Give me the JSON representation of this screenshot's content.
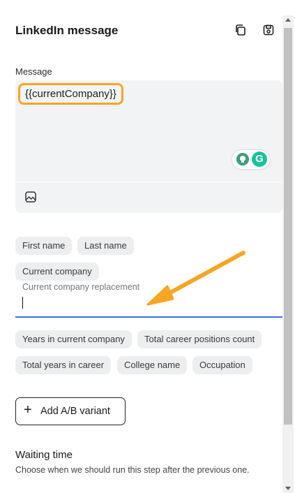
{
  "header": {
    "title": "LinkedIn message",
    "copy_icon": "copy-icon",
    "save_icon": "save-icon"
  },
  "message": {
    "label": "Message",
    "token_text": "{{currentCompany}}",
    "image_icon": "image-icon",
    "grammarly_letter": "G"
  },
  "variables": {
    "row1": [
      "First name",
      "Last name"
    ],
    "row2": [
      "Current company"
    ],
    "row3": [
      "Years in current company",
      "Total career positions count"
    ],
    "row4": [
      "Total years in career",
      "College name",
      "Occupation"
    ]
  },
  "replacement": {
    "label": "Current company replacement",
    "value": ""
  },
  "ab_button": {
    "label": "Add A/B variant"
  },
  "waiting": {
    "title": "Waiting time",
    "description": "Choose when we should run this step after the previous one."
  },
  "colors": {
    "highlight": "#f5a623",
    "arrow": "#f5a623",
    "focus_underline": "#3a6fd8",
    "grammarly": "#15c39a"
  }
}
